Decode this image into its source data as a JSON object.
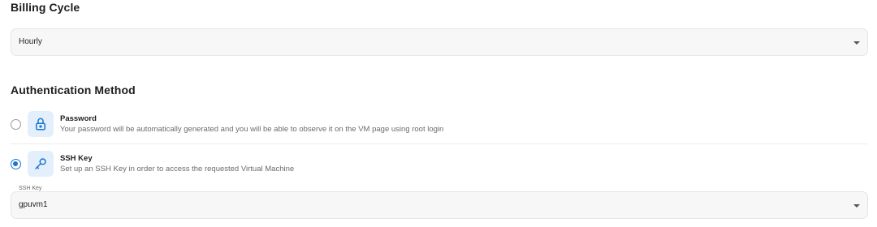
{
  "billing": {
    "title": "Billing Cycle",
    "selected": "Hourly"
  },
  "auth": {
    "title": "Authentication Method",
    "options": [
      {
        "title": "Password",
        "description": "Your password will be automatically generated and you will be able to observe it on the VM page using root login",
        "icon": "lock-icon",
        "checked": false
      },
      {
        "title": "SSH Key",
        "description": "Set up an SSH Key in order to access the requested Virtual Machine",
        "icon": "key-icon",
        "checked": true
      }
    ],
    "ssh_key": {
      "label": "SSH Key",
      "selected": "gpuvm1"
    }
  },
  "colors": {
    "accent": "#1976d2",
    "icon_tile_bg": "#e3f0fc",
    "field_bg": "#f7f7f7"
  }
}
